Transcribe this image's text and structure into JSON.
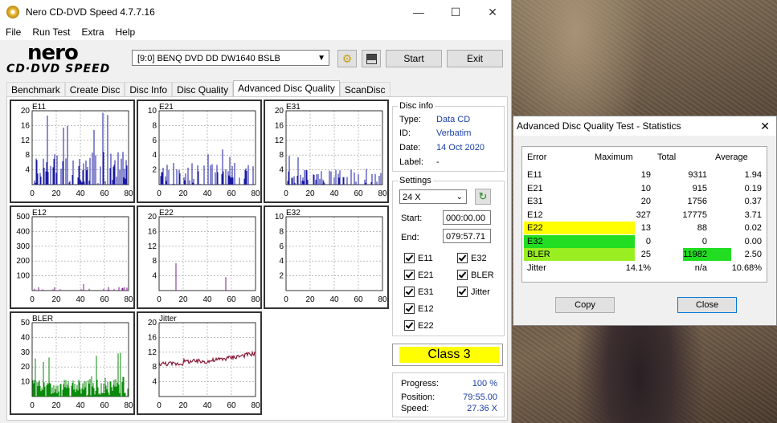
{
  "window": {
    "title": "Nero CD-DVD Speed 4.7.7.16"
  },
  "menu": [
    "File",
    "Run Test",
    "Extra",
    "Help"
  ],
  "logo": {
    "top": "nero",
    "bottom": "CD·DVD SPEED"
  },
  "toolbar": {
    "drive": "[9:0]   BENQ DVD DD DW1640 BSLB",
    "start": "Start",
    "exit": "Exit"
  },
  "tabs": [
    "Benchmark",
    "Create Disc",
    "Disc Info",
    "Disc Quality",
    "Advanced Disc Quality",
    "ScanDisc"
  ],
  "charts": [
    {
      "name": "E11",
      "yticks": [
        20,
        16,
        12,
        8,
        4
      ],
      "ymax": 20,
      "xticks": [
        0,
        20,
        40,
        60,
        80
      ],
      "color": "#1a1aa0",
      "type": "bars"
    },
    {
      "name": "E21",
      "yticks": [
        10,
        8,
        6,
        4,
        2
      ],
      "ymax": 10,
      "xticks": [
        0,
        20,
        40,
        60,
        80
      ],
      "color": "#1a1aa0",
      "type": "bars"
    },
    {
      "name": "E31",
      "yticks": [
        20,
        16,
        12,
        8,
        4
      ],
      "ymax": 20,
      "xticks": [
        0,
        20,
        40,
        60,
        80
      ],
      "color": "#1a1aa0",
      "type": "bars"
    },
    {
      "name": "E12",
      "yticks": [
        500,
        400,
        300,
        200,
        100
      ],
      "ymax": 500,
      "xticks": [
        0,
        20,
        40,
        60,
        80
      ],
      "color": "#7a1a8a",
      "type": "bars"
    },
    {
      "name": "E22",
      "yticks": [
        20,
        16,
        12,
        8,
        4
      ],
      "ymax": 20,
      "xticks": [
        0,
        20,
        40,
        60,
        80
      ],
      "color": "#7a1a8a",
      "type": "bars"
    },
    {
      "name": "E32",
      "yticks": [
        10,
        8,
        6,
        4,
        2
      ],
      "ymax": 10,
      "xticks": [
        0,
        20,
        40,
        60,
        80
      ],
      "color": "#7a1a8a",
      "type": "bars"
    },
    {
      "name": "BLER",
      "yticks": [
        50,
        40,
        30,
        20,
        10
      ],
      "ymax": 50,
      "xticks": [
        0,
        20,
        40,
        60,
        80
      ],
      "color": "#0a8a0a",
      "type": "bars"
    },
    {
      "name": "Jitter",
      "yticks": [
        20,
        16,
        12,
        8,
        4
      ],
      "ymax": 20,
      "xticks": [
        0,
        20,
        40,
        60,
        80
      ],
      "color": "#8a1a3a",
      "type": "line"
    }
  ],
  "disc_info": {
    "caption": "Disc info",
    "type_label": "Type:",
    "type": "Data CD",
    "id_label": "ID:",
    "id": "Verbatim",
    "date_label": "Date:",
    "date": "14 Oct 2020",
    "label_label": "Label:",
    "label": "-"
  },
  "settings": {
    "caption": "Settings",
    "speed": "24 X",
    "start_label": "Start:",
    "start": "000:00.00",
    "end_label": "End:",
    "end": "079:57.71"
  },
  "checks": {
    "e11": "E11",
    "e32": "E32",
    "e21": "E21",
    "bler": "BLER",
    "e31": "E31",
    "jitter": "Jitter",
    "e12": "E12",
    "e22": "E22"
  },
  "class": "Class 3",
  "progress": {
    "progress_label": "Progress:",
    "progress": "100 %",
    "position_label": "Position:",
    "position": "79:55.00",
    "speed_label": "Speed:",
    "speed": "27.36 X"
  },
  "stats": {
    "title": "Advanced Disc Quality Test - Statistics",
    "headers": [
      "Error",
      "Maximum",
      "Total",
      "Average"
    ],
    "rows": [
      {
        "error": "E11",
        "max": "19",
        "total": "9311",
        "avg": "1.94",
        "hl_error": "",
        "hl_avg": ""
      },
      {
        "error": "E21",
        "max": "10",
        "total": "915",
        "avg": "0.19",
        "hl_error": "",
        "hl_avg": ""
      },
      {
        "error": "E31",
        "max": "20",
        "total": "1756",
        "avg": "0.37",
        "hl_error": "",
        "hl_avg": ""
      },
      {
        "error": "E12",
        "max": "327",
        "total": "17775",
        "avg": "3.71",
        "hl_error": "",
        "hl_avg": ""
      },
      {
        "error": "E22",
        "max": "13",
        "total": "88",
        "avg": "0.02",
        "hl_error": "#ffff00",
        "hl_avg": ""
      },
      {
        "error": "E32",
        "max": "0",
        "total": "0",
        "avg": "0.00",
        "hl_error": "#22dd22",
        "hl_avg": ""
      },
      {
        "error": "BLER",
        "max": "25",
        "total": "11982",
        "avg": "2.50",
        "hl_error": "#99ee22",
        "hl_avg": "#22dd22"
      },
      {
        "error": "Jitter",
        "max": "14.1%",
        "total": "n/a",
        "avg": "10.68%",
        "hl_error": "",
        "hl_avg": ""
      }
    ],
    "copy": "Copy",
    "close": "Close"
  }
}
